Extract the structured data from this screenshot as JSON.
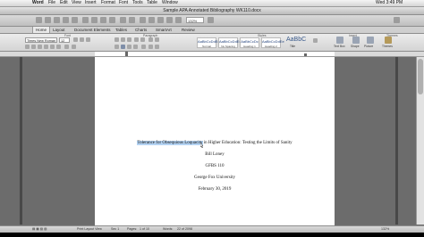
{
  "menubar": {
    "apple": "",
    "app": "Word",
    "items": [
      "File",
      "Edit",
      "View",
      "Insert",
      "Format",
      "Font",
      "Tools",
      "Table",
      "Window"
    ],
    "right": "Wed 3:49 PM"
  },
  "window": {
    "title": "Sample APA Annotated Bibliography WK110.docx"
  },
  "toolbar": {
    "zoom": "132%"
  },
  "tabs": [
    "Home",
    "Layout",
    "Document Elements",
    "Tables",
    "Charts",
    "SmartArt",
    "Review"
  ],
  "ribbon": {
    "groups": {
      "font": "Font",
      "paragraph": "Paragraph",
      "styles": "Styles",
      "insert": "Insert",
      "themes": "Themes"
    },
    "font_name": "Times New Roman",
    "font_size": "12",
    "styles": [
      {
        "sample": "AaBbCcDdEe",
        "name": "Normal"
      },
      {
        "sample": "AaBbCcDdEe",
        "name": "No Spacing"
      },
      {
        "sample": "AaBbCcDc",
        "name": "Heading 1"
      },
      {
        "sample": "AaBbCcDdEe",
        "name": "Heading 2"
      }
    ],
    "big_style": "AaBbC",
    "big_style_name": "Title",
    "insert_buttons": [
      "Text Box",
      "Shape",
      "Picture",
      "Themes"
    ]
  },
  "document": {
    "title_selected": "Tolerance for Obsequious Loquacity",
    "title_rest": " in Higher Education: Testing the Limits of Sanity",
    "author": "Bill Loney",
    "course": "GFBS 110",
    "school": "George Fox University",
    "date": "February 30, 2019"
  },
  "status": {
    "view": "Print Layout View",
    "sec": "Sec  1",
    "pages_label": "Pages:",
    "pages": "1 of 10",
    "words_label": "Words:",
    "words": "22 of 2098",
    "zoom": "132%"
  },
  "colors": {
    "selection": "#b4d3f3",
    "doc_bg": "#6c6c6c"
  }
}
